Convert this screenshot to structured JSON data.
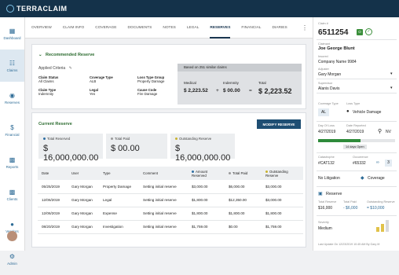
{
  "app": {
    "name": "TERRACLAIM"
  },
  "sidebar": {
    "items": [
      {
        "label": "Dashboard",
        "icon": "grid-icon"
      },
      {
        "label": "Claims",
        "icon": "claims-icon"
      },
      {
        "label": "Reserves",
        "icon": "reserves-icon"
      },
      {
        "label": "Financial",
        "icon": "dollar-icon"
      },
      {
        "label": "Reports",
        "icon": "reports-icon"
      },
      {
        "label": "Clients",
        "icon": "clients-icon"
      },
      {
        "label": "Vendors",
        "icon": "vendors-icon"
      },
      {
        "label": "Admin",
        "icon": "gear-icon"
      }
    ]
  },
  "tabs": [
    "OVERVIEW",
    "CLAIM INFO",
    "COVERAGE",
    "DOCUMENTS",
    "NOTES",
    "LEGAL",
    "RESERVES",
    "FINANCIAL",
    "DIARIES"
  ],
  "recommended": {
    "title": "Recommended Reserve",
    "applied_criteria_label": "Applied Criteria",
    "criteria": [
      {
        "label": "Claim Status",
        "value": "All Claims"
      },
      {
        "label": "Coverage Type",
        "value": "ALB"
      },
      {
        "label": "Loss Type Group",
        "value": "Property Damage"
      },
      {
        "label": "Claim Type",
        "value": "Indemnity"
      },
      {
        "label": "Legal",
        "value": "Yes"
      },
      {
        "label": "Cause Code",
        "value": "Fire Damage"
      }
    ],
    "based_on": "Based on 251 similar claims",
    "medical_label": "Medical",
    "medical_value": "$ 2,223.52",
    "indemnity_label": "Indemnity",
    "indemnity_value": "$ 00.00",
    "total_label": "Total",
    "total_value": "$ 2,223.52",
    "plus1": "+",
    "equals": "="
  },
  "current": {
    "title": "Current Reserve",
    "modify_label": "MODIFY RESERVE",
    "total_reserved_label": "Total Reserved",
    "total_reserved_value": "$ 16,000,000.00",
    "total_paid_label": "Total Paid",
    "total_paid_value": "$ 00.00",
    "outstanding_label": "Outstanding Reserve",
    "outstanding_value": "$ 16,000,000.00",
    "colors": {
      "reserved": "#2f6fa3",
      "paid": "#9a9a9a",
      "outstanding": "#c9b22d"
    }
  },
  "table": {
    "headers": [
      "Date",
      "User",
      "Type",
      "Comment",
      "Amount Reserved",
      "Total Paid",
      "Outstanding Reserve"
    ],
    "rows": [
      [
        "05/25/2019",
        "Gary Morgan",
        "Property Damage",
        "Setting initial reserve",
        "$3,000.00",
        "$6,000.00",
        "$3,000.00"
      ],
      [
        "12/06/2019",
        "Gary Morgan",
        "Legal",
        "Setting initial reserve",
        "$1,800.00",
        "$12,350.00",
        "$3,000.00"
      ],
      [
        "12/06/2019",
        "Gary Morgan",
        "Expense",
        "Setting initial reserve",
        "$1,800.00",
        "$1,800.00",
        "$1,800.00"
      ],
      [
        "08/20/2019",
        "Gary Morgan",
        "Investigation",
        "Setting initial reserve",
        "$1,759.00",
        "$0.00",
        "$1,759.00"
      ]
    ]
  },
  "claim": {
    "number_label": "Claim #",
    "number": "6511254",
    "badge": "O",
    "claimant_label": "Claimant",
    "claimant": "Joe George Blunt",
    "insured_label": "Insured",
    "insured": "Company Name 9984",
    "adjuster_label": "Adjuster",
    "adjuster": "Gary Morgan",
    "supervisor_label": "Supervisor",
    "supervisor": "Alanis Davis",
    "coverage_type_label": "Coverage Type",
    "coverage_type": "AL",
    "loss_type_label": "Loss Type",
    "loss_type": "Vehicle Damage",
    "dol_label": "Day Of Loss",
    "dol": "4/27/2019",
    "reported_label": "Date Reported",
    "reported": "4/27/2019",
    "state": "NV",
    "days_open": "14 days Open",
    "days_open_progress": 0.55,
    "catastrophe_label": "Catastrophe",
    "catastrophe": "#CAT132",
    "occurrence_label": "Occurrence",
    "occurrence": "#65332",
    "occurrence_count": "3",
    "litigation": "No Litigation",
    "coverage": "Coverage",
    "reserve_title": "Reserve",
    "total_reserve_label": "Total Reserve",
    "total_reserve": "$16,000",
    "total_paid_label": "Total Paid",
    "total_paid": "- $6,000",
    "outstanding_label": "Outstanding Reserve",
    "outstanding": "= $10,000",
    "severity_label": "Severity",
    "severity": "Medium",
    "last_update": "Last Update On 12/23/2019 10:45 AM By Gary M"
  }
}
